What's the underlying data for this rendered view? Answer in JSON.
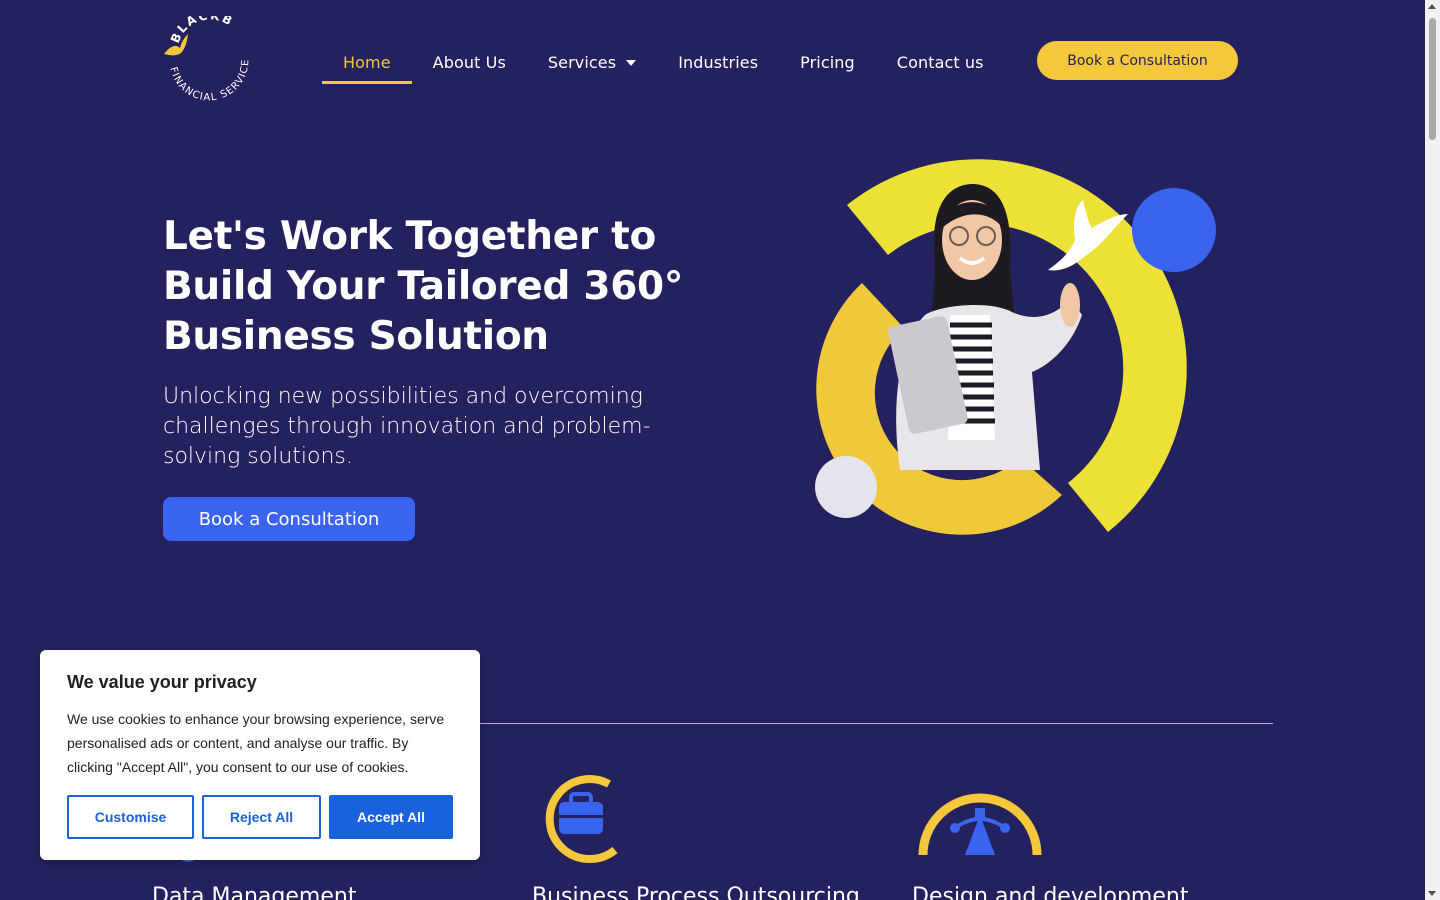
{
  "logo": {
    "top_text": "BLACKB",
    "bottom_text": "FINANCIAL SERVICES",
    "icon": "bird-icon"
  },
  "nav": {
    "items": [
      {
        "label": "Home",
        "active": true
      },
      {
        "label": "About Us"
      },
      {
        "label": "Services",
        "has_dropdown": true
      },
      {
        "label": "Industries"
      },
      {
        "label": "Pricing"
      },
      {
        "label": "Contact us"
      }
    ],
    "cta_label": "Book a Consultation"
  },
  "hero": {
    "title": "Let's Work Together to Build Your Tailored 360° Business Solution",
    "subtitle": "Unlocking new possibilities and overcoming challenges through innovation and problem-solving solutions.",
    "cta_label": "Book a Consultation"
  },
  "services": [
    {
      "title": "Data Management",
      "icon": "data-management-icon"
    },
    {
      "title": "Business Process Outsourcing",
      "icon": "briefcase-icon"
    },
    {
      "title": "Design and development",
      "icon": "vector-design-icon"
    }
  ],
  "cookie": {
    "title": "We value your privacy",
    "text": "We use cookies to enhance your browsing experience, serve personalised ads or content, and analyse our traffic. By clicking \"Accept All\", you consent to our use of cookies.",
    "customise": "Customise",
    "reject": "Reject All",
    "accept": "Accept All"
  },
  "colors": {
    "background": "#23225f",
    "accent_yellow": "#f5c73b",
    "accent_blue": "#3a63f0",
    "cookie_blue": "#1863dc"
  }
}
